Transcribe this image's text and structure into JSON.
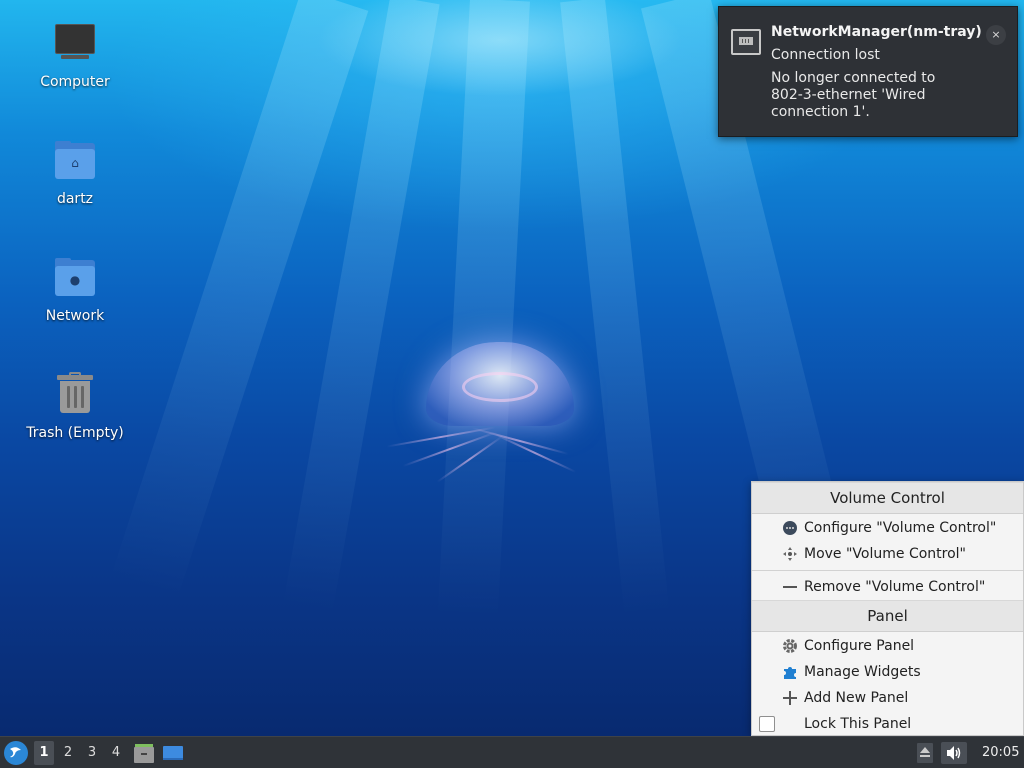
{
  "desktop": {
    "icons": [
      {
        "label": "Computer",
        "icon": "computer-icon"
      },
      {
        "label": "dartz",
        "icon": "home-folder-icon"
      },
      {
        "label": "Network",
        "icon": "network-folder-icon"
      },
      {
        "label": "Trash (Empty)",
        "icon": "trash-icon"
      }
    ]
  },
  "notification": {
    "title": "NetworkManager(nm-tray)",
    "subtitle": "Connection lost",
    "body": "No longer connected to 802-3-ethernet 'Wired connection 1'.",
    "close_label": "×",
    "icon": "ethernet-port-icon"
  },
  "context_menu": {
    "section1_title": "Volume Control",
    "configure_widget": "Configure \"Volume Control\"",
    "move_widget": "Move \"Volume Control\"",
    "remove_widget": "Remove \"Volume Control\"",
    "section2_title": "Panel",
    "configure_panel": "Configure Panel",
    "manage_widgets": "Manage Widgets",
    "add_new_panel": "Add New Panel",
    "lock_panel": "Lock This Panel",
    "lock_checked": false
  },
  "taskbar": {
    "workspaces": [
      "1",
      "2",
      "3",
      "4"
    ],
    "active_workspace": "1",
    "clock": "20:05"
  },
  "colors": {
    "accent": "#2b87d6",
    "panel_bg": "#2f3338",
    "notification_bg": "#2e3136"
  }
}
